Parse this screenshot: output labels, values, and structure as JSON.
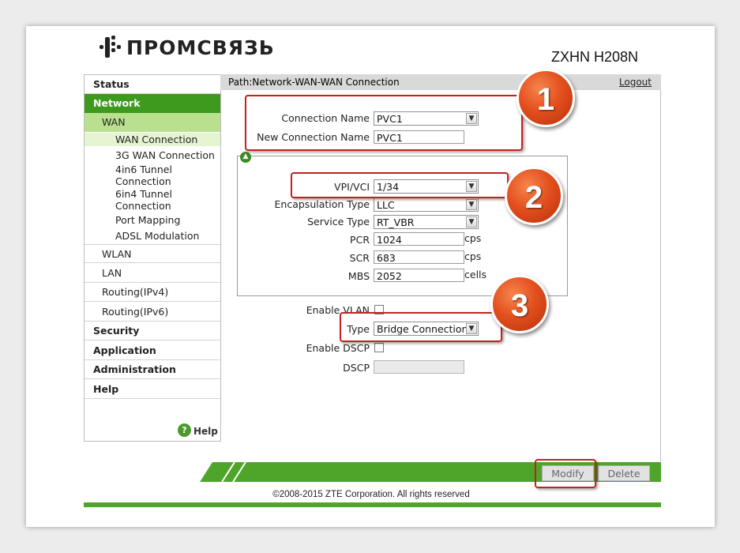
{
  "header": {
    "logo_text": "ПРОМСВЯЗЬ",
    "model": "ZXHN H208N"
  },
  "sidebar": {
    "items": [
      {
        "label": "Status"
      },
      {
        "label": "Network"
      },
      {
        "label": "WAN"
      },
      {
        "label": "WAN Connection"
      },
      {
        "label": "3G WAN Connection"
      },
      {
        "label": "4in6 Tunnel Connection"
      },
      {
        "label": "6in4 Tunnel Connection"
      },
      {
        "label": "Port Mapping"
      },
      {
        "label": "ADSL Modulation"
      },
      {
        "label": "WLAN"
      },
      {
        "label": "LAN"
      },
      {
        "label": "Routing(IPv4)"
      },
      {
        "label": "Routing(IPv6)"
      },
      {
        "label": "Security"
      },
      {
        "label": "Application"
      },
      {
        "label": "Administration"
      },
      {
        "label": "Help"
      }
    ],
    "help_label": "Help"
  },
  "pathbar": {
    "path": "Path:Network-WAN-WAN Connection",
    "logout": "Logout"
  },
  "form": {
    "connection_name_label": "Connection Name",
    "connection_name_value": "PVC1",
    "new_connection_name_label": "New Connection Name",
    "new_connection_name_value": "PVC1",
    "vpi_vci_label": "VPI/VCI",
    "vpi_vci_value": "1/34",
    "encapsulation_label": "Encapsulation Type",
    "encapsulation_value": "LLC",
    "service_type_label": "Service Type",
    "service_type_value": "RT_VBR",
    "pcr_label": "PCR",
    "pcr_value": "1024",
    "pcr_unit": "cps",
    "scr_label": "SCR",
    "scr_value": "683",
    "scr_unit": "cps",
    "mbs_label": "MBS",
    "mbs_value": "2052",
    "mbs_unit": "cells",
    "enable_vlan_label": "Enable VLAN",
    "type_label": "Type",
    "type_value": "Bridge Connection",
    "enable_dscp_label": "Enable DSCP",
    "dscp_label": "DSCP",
    "dscp_value": ""
  },
  "callouts": {
    "one": "1",
    "two": "2",
    "three": "3"
  },
  "buttons": {
    "modify": "Modify",
    "delete": "Delete"
  },
  "footer": {
    "copyright": "©2008-2015 ZTE Corporation. All rights reserved"
  },
  "colors": {
    "accent_green": "#3e9a1e",
    "callout_red": "#c42121",
    "badge_orange": "#e3501e"
  }
}
